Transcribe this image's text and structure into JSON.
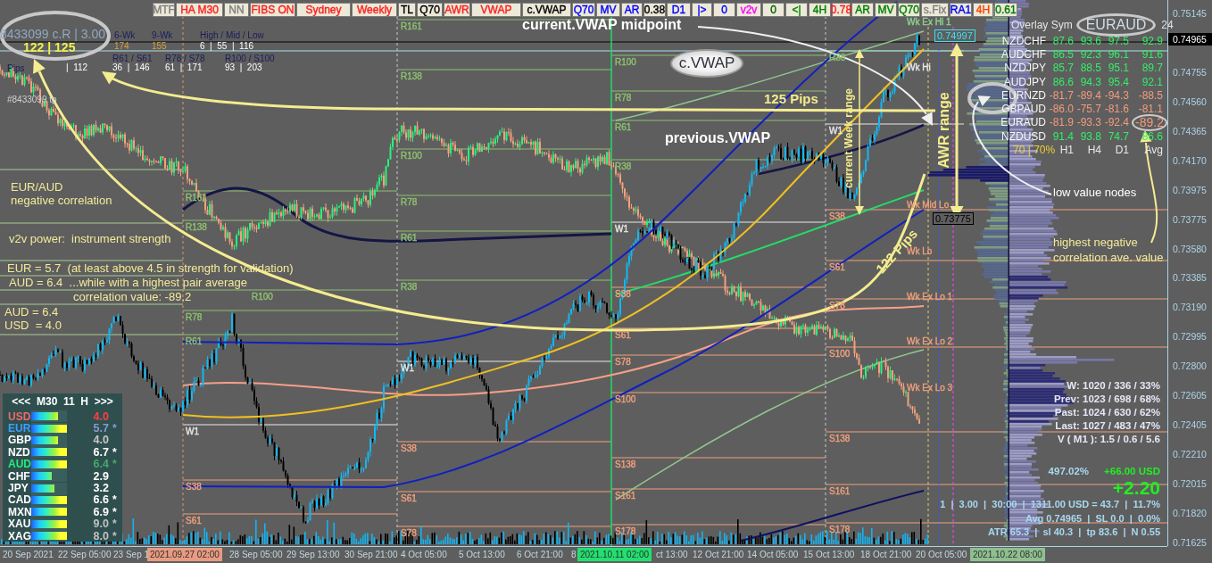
{
  "toolbar": {
    "buttons": [
      {
        "label": "MTF",
        "color": "#808080"
      },
      {
        "label": "HA M30",
        "color": "#ff2020"
      },
      {
        "label": "NN",
        "color": "#808080"
      },
      {
        "label": "FIBS ON",
        "color": "#ff2020"
      },
      {
        "label": "Sydney",
        "color": "#ff2020"
      },
      {
        "label": "Weekly",
        "color": "#ff2020"
      },
      {
        "label": "TL",
        "color": "#000000"
      },
      {
        "label": "Q70",
        "color": "#000000"
      },
      {
        "label": "AWR",
        "color": "#ff2020"
      },
      {
        "label": "VWAP",
        "color": "#ff2020"
      },
      {
        "label": "c.VWAP",
        "color": "#000000"
      },
      {
        "label": "Q70",
        "color": "#0000ff"
      },
      {
        "label": "MV",
        "color": "#0000ff"
      },
      {
        "label": "AR",
        "color": "#0000ff"
      },
      {
        "label": "0.38",
        "color": "#000000"
      },
      {
        "label": "D1",
        "color": "#0000ff"
      },
      {
        "label": "|>",
        "color": "#0000ff"
      },
      {
        "label": "0",
        "color": "#0000ff"
      },
      {
        "label": "v2v",
        "color": "#ff00ff"
      },
      {
        "label": "0",
        "color": "#006400"
      },
      {
        "label": "<|",
        "color": "#008000"
      },
      {
        "label": "4H",
        "color": "#008000"
      },
      {
        "label": "0.78",
        "color": "#ff2020"
      },
      {
        "label": "AR",
        "color": "#008000"
      },
      {
        "label": "MV",
        "color": "#008000"
      },
      {
        "label": "Q70",
        "color": "#008000"
      },
      {
        "label": "s.Fix",
        "color": "#808080"
      },
      {
        "label": "RA1",
        "color": "#0000ff"
      },
      {
        "label": "4H",
        "color": "#ff4500"
      },
      {
        "label": "0.61",
        "color": "#008000"
      }
    ]
  },
  "info_panel": {
    "account": "8433099 c.R | 3.00",
    "range": "122 | 125",
    "columns": [
      {
        "header": "6-Wk",
        "value": "174"
      },
      {
        "header": "9-Wk",
        "value": "155"
      },
      {
        "header": "High / Mid / Low",
        "value": "6  |  55  |  116"
      }
    ],
    "fib_columns": [
      {
        "header": "R61 / S61",
        "value": "36  |  146"
      },
      {
        "header": "R78 / S78",
        "value": "61  |  171"
      },
      {
        "header": "R100 / S100",
        "value": "93  |  203"
      }
    ],
    "pips_label": "Pips",
    "pips_value": "|  112",
    "ticket": "#8433099 tp"
  },
  "annotations": [
    {
      "text": "current.VWAP midpoint",
      "kind": "callout"
    },
    {
      "text": "c.VWAP",
      "kind": "bubble"
    },
    {
      "text": "125 Pips",
      "kind": "measure"
    },
    {
      "text": "previous.VWAP",
      "kind": "callout"
    },
    {
      "text": "current Week range",
      "kind": "vertical"
    },
    {
      "text": "AWR range",
      "kind": "vertical"
    },
    {
      "text": "122 Pips",
      "kind": "slanted"
    },
    {
      "text": "EUR/AUD",
      "kind": "note"
    },
    {
      "text": "negative correlation",
      "kind": "note"
    },
    {
      "text": "v2v power:  instrument strength",
      "kind": "note"
    },
    {
      "text": "EUR = 5.7  (at least above 4.5 in strength for validation)",
      "kind": "note"
    },
    {
      "text": "AUD = 6.4  ...while with a highest pair average",
      "kind": "note"
    },
    {
      "text": "correlation value: -89.2",
      "kind": "note"
    },
    {
      "text": "AUD = 6.4",
      "kind": "note"
    },
    {
      "text": "USD  = 4.0",
      "kind": "note"
    },
    {
      "text": "low value nodes",
      "kind": "hint"
    },
    {
      "text": "highest negative",
      "kind": "note"
    },
    {
      "text": "correlation ave. value",
      "kind": "note"
    }
  ],
  "price_tags": [
    {
      "text": "0.74997",
      "kind": "high"
    },
    {
      "text": "0.73775",
      "kind": "low"
    }
  ],
  "levels": {
    "sections": [
      {
        "labels": [
          {
            "text": "R161",
            "color": "#8cc070"
          },
          {
            "text": "R138",
            "color": "#8cc070"
          },
          {
            "text": "R100",
            "color": "#8cc070"
          },
          {
            "text": "R78",
            "color": "#8cc070"
          },
          {
            "text": "R61",
            "color": "#8cc070"
          },
          {
            "text": "W1",
            "color": "#e8e8e8"
          },
          {
            "text": "S38",
            "color": "#f0a07c"
          },
          {
            "text": "S61",
            "color": "#f0a07c"
          }
        ]
      },
      {
        "labels": [
          {
            "text": "R161",
            "color": "#8cc070"
          },
          {
            "text": "R138",
            "color": "#8cc070"
          },
          {
            "text": "R100",
            "color": "#8cc070"
          },
          {
            "text": "R78",
            "color": "#8cc070"
          },
          {
            "text": "R61",
            "color": "#8cc070"
          },
          {
            "text": "R38",
            "color": "#8cc070"
          },
          {
            "text": "W1",
            "color": "#e8e8e8"
          },
          {
            "text": "S38",
            "color": "#f0a07c"
          },
          {
            "text": "S61",
            "color": "#f0a07c"
          },
          {
            "text": "S78",
            "color": "#f0a07c"
          }
        ]
      },
      {
        "labels": [
          {
            "text": "R100",
            "color": "#8cc070"
          },
          {
            "text": "R78",
            "color": "#8cc070"
          },
          {
            "text": "R61",
            "color": "#8cc070"
          },
          {
            "text": "R38",
            "color": "#8cc070"
          },
          {
            "text": "W1",
            "color": "#e8e8e8"
          },
          {
            "text": "S38",
            "color": "#f0a07c"
          },
          {
            "text": "S61",
            "color": "#f0a07c"
          },
          {
            "text": "S78",
            "color": "#f0a07c"
          },
          {
            "text": "S100",
            "color": "#f0a07c"
          },
          {
            "text": "S138",
            "color": "#f0a07c"
          },
          {
            "text": "S161",
            "color": "#f0a07c"
          },
          {
            "text": "S178",
            "color": "#f0a07c"
          }
        ]
      },
      {
        "labels": [
          {
            "text": "R38",
            "color": "#8cc070"
          },
          {
            "text": "W1",
            "color": "#e8e8e8"
          },
          {
            "text": "S38",
            "color": "#f0a07c"
          },
          {
            "text": "S61",
            "color": "#f0a07c"
          },
          {
            "text": "S78",
            "color": "#f0a07c"
          },
          {
            "text": "S100",
            "color": "#f0a07c"
          },
          {
            "text": "S138",
            "color": "#f0a07c"
          },
          {
            "text": "S161",
            "color": "#f0a07c"
          },
          {
            "text": "S178",
            "color": "#f0a07c"
          }
        ]
      },
      {
        "labels": [
          {
            "text": "Wk Ex Hi 1",
            "color": "#90d090"
          },
          {
            "text": "Wk Hi",
            "color": "#e8e8e8"
          },
          {
            "text": "Wk Mid Lo",
            "color": "#f0a07c"
          },
          {
            "text": "Wk Lo",
            "color": "#f0a07c"
          },
          {
            "text": "Wk Ex Lo 1",
            "color": "#f0a07c"
          },
          {
            "text": "Wk Ex Lo 2",
            "color": "#f0a07c"
          },
          {
            "text": "Wk Ex Lo 3",
            "color": "#f0a07c"
          }
        ]
      }
    ]
  },
  "correlation": {
    "title": "Overlay Sym",
    "symbol": "EURAUD",
    "count": "24",
    "rows": [
      {
        "pair": "NZDCHF",
        "values": [
          "87.6",
          "93.6",
          "97.5",
          "92.9"
        ],
        "color": "#33ee66",
        "highlighted": false
      },
      {
        "pair": "AUDCHF",
        "values": [
          "86.5",
          "92.3",
          "96.1",
          "91.6"
        ],
        "color": "#33ee66",
        "highlighted": false
      },
      {
        "pair": "NZDJPY",
        "values": [
          "85.7",
          "88.5",
          "95.1",
          "89.7"
        ],
        "color": "#33ee66",
        "highlighted": false
      },
      {
        "pair": "AUDJPY",
        "values": [
          "86.6",
          "94.3",
          "95.4",
          "92.1"
        ],
        "color": "#33ee66",
        "highlighted": false
      },
      {
        "pair": "EURNZD",
        "values": [
          "-81.7",
          "-89.4",
          "-94.3",
          "-88.5"
        ],
        "color": "#f49a7c",
        "highlighted": false
      },
      {
        "pair": "GBPAUD",
        "values": [
          "-86.0",
          "-75.7",
          "-81.6",
          "-81.1"
        ],
        "color": "#f49a7c",
        "highlighted": false
      },
      {
        "pair": "EURAUD",
        "values": [
          "-81.9",
          "-93.3",
          "-92.4",
          "-89.2"
        ],
        "color": "#f49a7c",
        "highlighted": true
      },
      {
        "pair": "NZDUSD",
        "values": [
          "91.4",
          "93.8",
          "74.7",
          "86.6"
        ],
        "color": "#33ee66",
        "highlighted": false
      }
    ],
    "footer": {
      "label": "70 | 70%",
      "columns": [
        "H1",
        "H4",
        "D1",
        "Avg"
      ]
    }
  },
  "strength": {
    "header": "<<<  M30  11  H  >>>",
    "rows": [
      {
        "currency": "USD",
        "color": "#f06868",
        "level": 0.75,
        "value": {
          "text": "4.0",
          "color": "#ff4040"
        }
      },
      {
        "currency": "EUR",
        "color": "#3aa0ff",
        "level": 1,
        "value": {
          "text": "5.7",
          "color": "#8898d0"
        },
        "flag": "*"
      },
      {
        "currency": "GBP",
        "color": "#ffffff",
        "level": 0.75,
        "value": {
          "text": "4.0",
          "color": "#c8c8c8"
        }
      },
      {
        "currency": "NZD",
        "color": "#ffffff",
        "level": 1,
        "value": {
          "text": "6.7",
          "color": "#ffffff"
        },
        "flag": "*"
      },
      {
        "currency": "AUD",
        "color": "#22ee77",
        "level": 1,
        "value": {
          "text": "6.4",
          "color": "#44aa66"
        },
        "flag": "*"
      },
      {
        "currency": "CHF",
        "color": "#ffffff",
        "level": 0.58,
        "value": {
          "text": "2.9",
          "color": "#ffffff"
        }
      },
      {
        "currency": "JPY",
        "color": "#ffffff",
        "level": 0.65,
        "value": {
          "text": "3.2",
          "color": "#ffffff"
        }
      },
      {
        "currency": "CAD",
        "color": "#ffffff",
        "level": 1,
        "value": {
          "text": "6.6",
          "color": "#ffffff"
        },
        "flag": "*"
      },
      {
        "currency": "MXN",
        "color": "#ffffff",
        "level": 1,
        "value": {
          "text": "6.9",
          "color": "#ffffff"
        },
        "flag": "*"
      },
      {
        "currency": "XAU",
        "color": "#ffffff",
        "level": 1,
        "value": {
          "text": "9.0",
          "color": "#c0c0c0"
        },
        "flag": "*"
      },
      {
        "currency": "XAG",
        "color": "#ffffff",
        "level": 1,
        "value": {
          "text": "8.0",
          "color": "#c0c0c0"
        },
        "flag": "*"
      }
    ]
  },
  "stats": {
    "lines": [
      "W: 1020 / 336 / 33%",
      "Prev: 1023 / 698 / 68%",
      "Past: 1024 / 630 / 62%",
      "Last: 1027 / 483 / 47%",
      "V ( M1 ): 1.5 / 0.6 / 5.6"
    ],
    "percent": "497.02%",
    "profit": "+66.00 USD",
    "pips": "+2.20",
    "trade_lines": [
      "1  |  3.00  |  30:00  |  1311.00 USD = 43.7  |  11.7%",
      "Avg 0.74965  |  SL 0.0  |  0.0%",
      "ATR 65.3  |  sl 40.3  |  tp 83.6  |  N 0.55"
    ]
  },
  "price_axis": {
    "current": "0.74965",
    "ticks": [
      "0.75145",
      "0.74755",
      "0.74560",
      "0.74365",
      "0.74170",
      "0.73975",
      "0.73775",
      "0.73580",
      "0.73385",
      "0.73190",
      "0.72995",
      "0.72800",
      "0.72605",
      "0.72405",
      "0.72210",
      "0.72015",
      "0.71820",
      "0.71625"
    ]
  },
  "time_axis": {
    "ticks": [
      "20 Sep 2021",
      "22 Sep 05:00",
      "23 Sep 1",
      "28 Sep 05:00",
      "29 Sep 13:00",
      "30 Sep 21:00",
      "4 Oct 05:00",
      "5 Oct 13:00",
      "6 Oct 21:00",
      "8",
      "ct 13:00",
      "12 Oct 21:00",
      "14 Oct 05:00",
      "15 Oct 13:00",
      "18 Oct 21:00",
      "20 Oct 05:00"
    ],
    "cursors": [
      {
        "text": "2021.09.27 02:00",
        "color": "#e99a80"
      },
      {
        "text": "2021.10.11 02:00",
        "color": "#22e070"
      },
      {
        "text": "2021.10.22 08:00",
        "color": "#8fbf8f"
      }
    ]
  }
}
